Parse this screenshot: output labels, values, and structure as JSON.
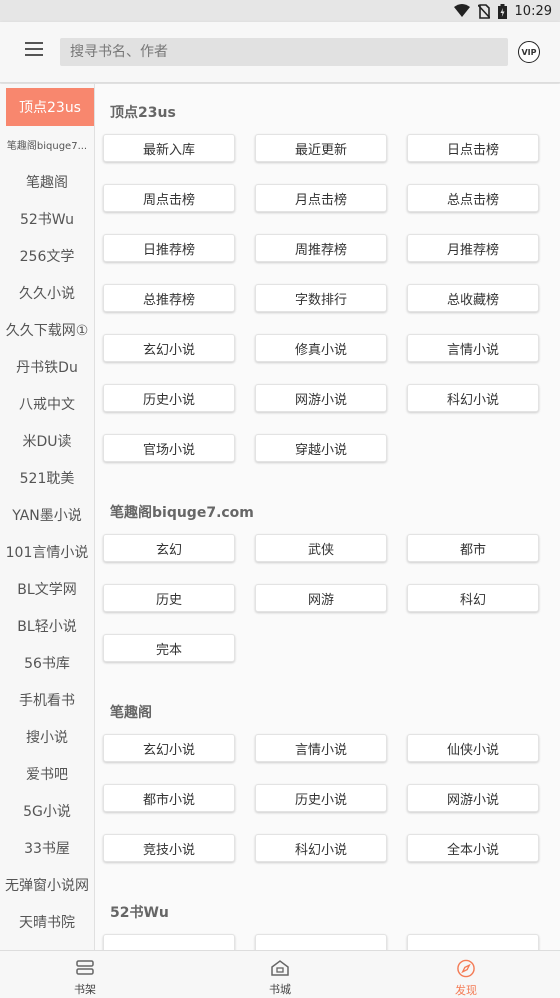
{
  "status": {
    "time": "10:29"
  },
  "search": {
    "placeholder": "搜寻书名、作者"
  },
  "vip_label": "VIP",
  "sidebar": {
    "items": [
      {
        "label": "顶点23us"
      },
      {
        "label": "笔趣阁biquge7..."
      },
      {
        "label": "笔趣阁"
      },
      {
        "label": "52书Wu"
      },
      {
        "label": "256文学"
      },
      {
        "label": "久久小说"
      },
      {
        "label": "久久下载网①"
      },
      {
        "label": "丹书铁Du"
      },
      {
        "label": "八戒中文"
      },
      {
        "label": "米DU读"
      },
      {
        "label": "521耽美"
      },
      {
        "label": "YAN墨小说"
      },
      {
        "label": "101言情小说"
      },
      {
        "label": "BL文学网"
      },
      {
        "label": "BL轻小说"
      },
      {
        "label": "56书库"
      },
      {
        "label": "手机看书"
      },
      {
        "label": "搜小说"
      },
      {
        "label": "爱书吧"
      },
      {
        "label": "5G小说"
      },
      {
        "label": "33书屋"
      },
      {
        "label": "无弹窗小说网"
      },
      {
        "label": "天晴书院"
      }
    ]
  },
  "sections": [
    {
      "title": "顶点23us",
      "tags": [
        "最新入库",
        "最近更新",
        "日点击榜",
        "周点击榜",
        "月点击榜",
        "总点击榜",
        "日推荐榜",
        "周推荐榜",
        "月推荐榜",
        "总推荐榜",
        "字数排行",
        "总收藏榜",
        "玄幻小说",
        "修真小说",
        "言情小说",
        "历史小说",
        "网游小说",
        "科幻小说",
        "官场小说",
        "穿越小说"
      ]
    },
    {
      "title": "笔趣阁biquge7.com",
      "tags": [
        "玄幻",
        "武侠",
        "都市",
        "历史",
        "网游",
        "科幻",
        "完本"
      ]
    },
    {
      "title": "笔趣阁",
      "tags": [
        "玄幻小说",
        "言情小说",
        "仙侠小说",
        "都市小说",
        "历史小说",
        "网游小说",
        "竞技小说",
        "科幻小说",
        "全本小说"
      ]
    },
    {
      "title": "52书Wu",
      "tags": [
        "",
        "",
        ""
      ]
    }
  ],
  "bottom_nav": {
    "shelf": "书架",
    "store": "书城",
    "discover": "发现"
  },
  "colors": {
    "accent": "#f47b55",
    "active_sidebar": "#f8876e"
  }
}
